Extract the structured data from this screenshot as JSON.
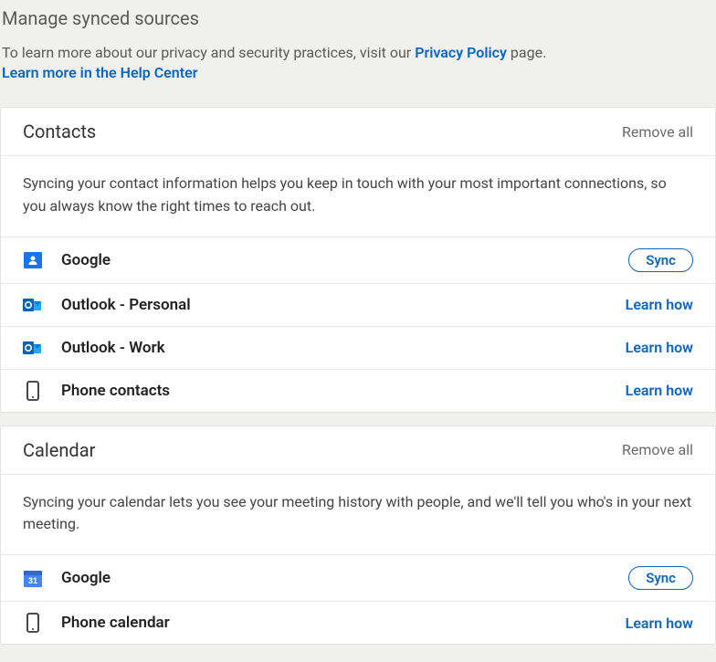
{
  "header": {
    "title": "Manage synced sources",
    "desc_prefix": "To learn more about our privacy and security practices, visit our ",
    "privacy_link": "Privacy Policy",
    "desc_suffix": " page.",
    "help_link": "Learn more in the Help Center"
  },
  "contacts": {
    "title": "Contacts",
    "remove_all": "Remove all",
    "desc": "Syncing your contact information helps you keep in touch with your most important connections, so you always know the right times to reach out.",
    "sources": {
      "google": {
        "label": "Google",
        "action": "Sync"
      },
      "outlook_personal": {
        "label": "Outlook - Personal",
        "action": "Learn how"
      },
      "outlook_work": {
        "label": "Outlook - Work",
        "action": "Learn how"
      },
      "phone": {
        "label": "Phone contacts",
        "action": "Learn how"
      }
    }
  },
  "calendar": {
    "title": "Calendar",
    "remove_all": "Remove all",
    "desc": "Syncing your calendar lets you see your meeting history with people, and we'll tell you who's in your next meeting.",
    "sources": {
      "google": {
        "label": "Google",
        "action": "Sync"
      },
      "phone": {
        "label": "Phone calendar",
        "action": "Learn how"
      }
    }
  }
}
